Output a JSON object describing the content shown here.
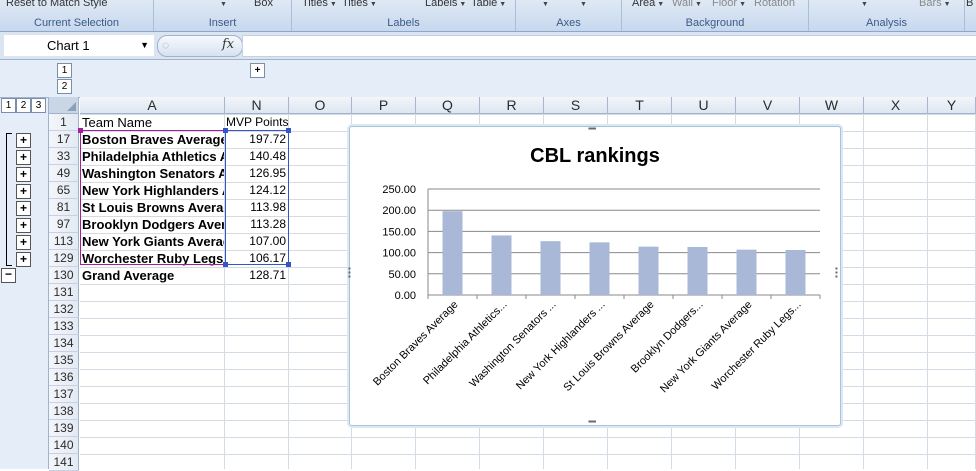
{
  "ribbon": {
    "groups": [
      {
        "title": "Current Selection",
        "controls": [
          "Reset to Match Style"
        ]
      },
      {
        "title": "Insert",
        "controls": [
          "Box"
        ]
      },
      {
        "title": "Labels",
        "controls": [
          "Titles",
          "Titles",
          "Labels",
          "Table"
        ]
      },
      {
        "title": "Axes",
        "controls": [
          ""
        ]
      },
      {
        "title": "Background",
        "controls": [
          "Area",
          "Wall",
          "Floor",
          "Rotation"
        ]
      },
      {
        "title": "Analysis",
        "controls": [
          "Bars"
        ]
      }
    ],
    "extra": "B"
  },
  "formula_bar": {
    "name_box": "Chart 1",
    "fx_label": "fx",
    "formula": ""
  },
  "outline": {
    "column_levels": [
      "1",
      "2"
    ],
    "row_levels": [
      "1",
      "2",
      "3"
    ],
    "expand": "+",
    "collapse": "−"
  },
  "columns": [
    "A",
    "N",
    "O",
    "P",
    "Q",
    "R",
    "S",
    "T",
    "U",
    "V",
    "W",
    "X",
    "Y"
  ],
  "row_numbers": [
    "1",
    "17",
    "33",
    "49",
    "65",
    "81",
    "97",
    "113",
    "129",
    "130",
    "131",
    "132",
    "133",
    "134",
    "135",
    "136",
    "137",
    "138",
    "139",
    "140",
    "141"
  ],
  "header_row": {
    "team": "Team Name",
    "points": "MVP Points"
  },
  "rows": [
    {
      "team": "Boston Braves Average",
      "points": "197.72"
    },
    {
      "team": "Philadelphia Athletics Average",
      "points": "140.48"
    },
    {
      "team": "Washington Senators Average",
      "points": "126.95"
    },
    {
      "team": "New York Highlanders Average",
      "points": "124.12"
    },
    {
      "team": "St Louis Browns Average",
      "points": "113.98"
    },
    {
      "team": "Brooklyn Dodgers Average",
      "points": "113.28"
    },
    {
      "team": "New York Giants Average",
      "points": "107.00"
    },
    {
      "team": "Worchester Ruby Legs Average",
      "points": "106.17"
    }
  ],
  "grand_total": {
    "team": "Grand Average",
    "points": "128.71"
  },
  "chart_data": {
    "type": "bar",
    "title": "CBL rankings",
    "categories": [
      "Boston Braves Average",
      "Philadelphia Athletics...",
      "Washington Senators ...",
      "New York Highlanders ...",
      "St Louis Browns Average",
      "Brooklyn Dodgers...",
      "New York Giants Average",
      "Worchester Ruby Legs..."
    ],
    "values": [
      197.72,
      140.48,
      126.95,
      124.12,
      113.98,
      113.28,
      107.0,
      106.17
    ],
    "yticks": [
      "0.00",
      "50.00",
      "100.00",
      "150.00",
      "200.00",
      "250.00"
    ],
    "ylim": [
      0,
      250
    ],
    "grid": true,
    "bar_color": "#a9b8d7"
  }
}
